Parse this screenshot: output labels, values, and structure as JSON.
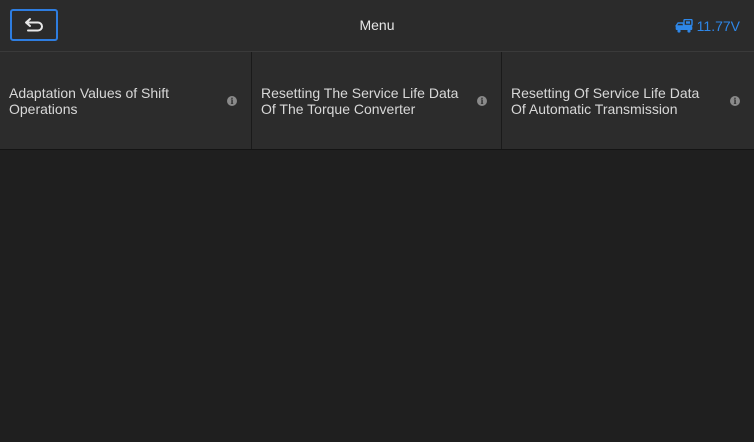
{
  "header": {
    "title": "Menu",
    "voltage": "11.77V"
  },
  "icons": {
    "back": "back-arrow-icon",
    "vehicle": "vehicle-connection-icon",
    "info": "info-icon"
  },
  "colors": {
    "accent": "#2e7de0",
    "background": "#1f1f1f",
    "header_bg": "#2b2b2b",
    "text": "#e6e6e6"
  },
  "menu": {
    "items": [
      {
        "label": "Adaptation Values of Shift Operations",
        "info": "i"
      },
      {
        "label": "Resetting The Service Life Data Of The Torque Converter",
        "info": "i"
      },
      {
        "label": "Resetting Of Service Life Data Of Automatic Transmission",
        "info": "i"
      }
    ]
  }
}
